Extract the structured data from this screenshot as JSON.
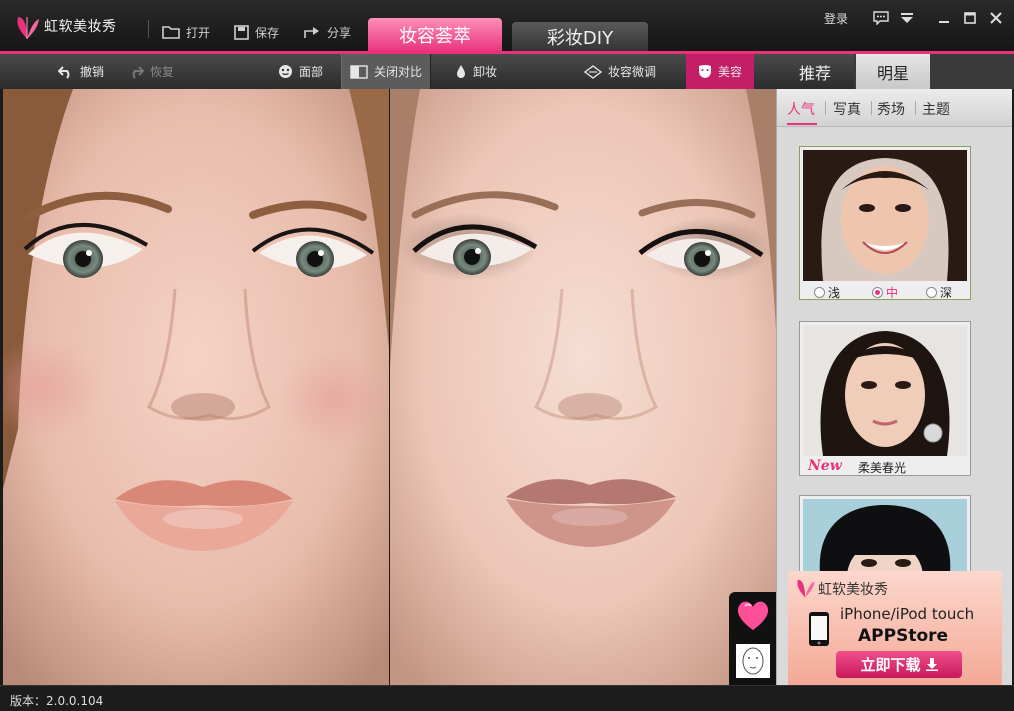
{
  "app": {
    "title": "虹软美妆秀"
  },
  "topbar": {
    "open": "打开",
    "save": "保存",
    "share": "分享",
    "tabs": [
      "妆容荟萃",
      "彩妆DIY"
    ],
    "active_tab": "妆容荟萃",
    "login": "登录"
  },
  "toolbar": {
    "undo": "撤销",
    "redo": "恢复",
    "face": "面部",
    "compare_toggle": "关闭对比",
    "remove_makeup": "卸妆",
    "fine_tune": "妆容微调",
    "beautify": "美容"
  },
  "sidebar": {
    "tabs": [
      "推荐",
      "明星"
    ],
    "active_tab": "明星",
    "subtabs": [
      "人气",
      "写真",
      "秀场",
      "主题"
    ],
    "active_subtab": "人气",
    "cards": [
      {
        "options": [
          "浅",
          "中",
          "深"
        ],
        "selected": "中"
      },
      {
        "badge": "New",
        "name": "柔美春光"
      },
      {}
    ]
  },
  "ad": {
    "brand": "虹软美妆秀",
    "line1": "iPhone/iPod touch",
    "line2": "APPStore",
    "button": "立即下载"
  },
  "status": {
    "version": "版本：2.0.0.104"
  },
  "colors": {
    "accent": "#e8327c",
    "accent_dark": "#c41f66"
  }
}
